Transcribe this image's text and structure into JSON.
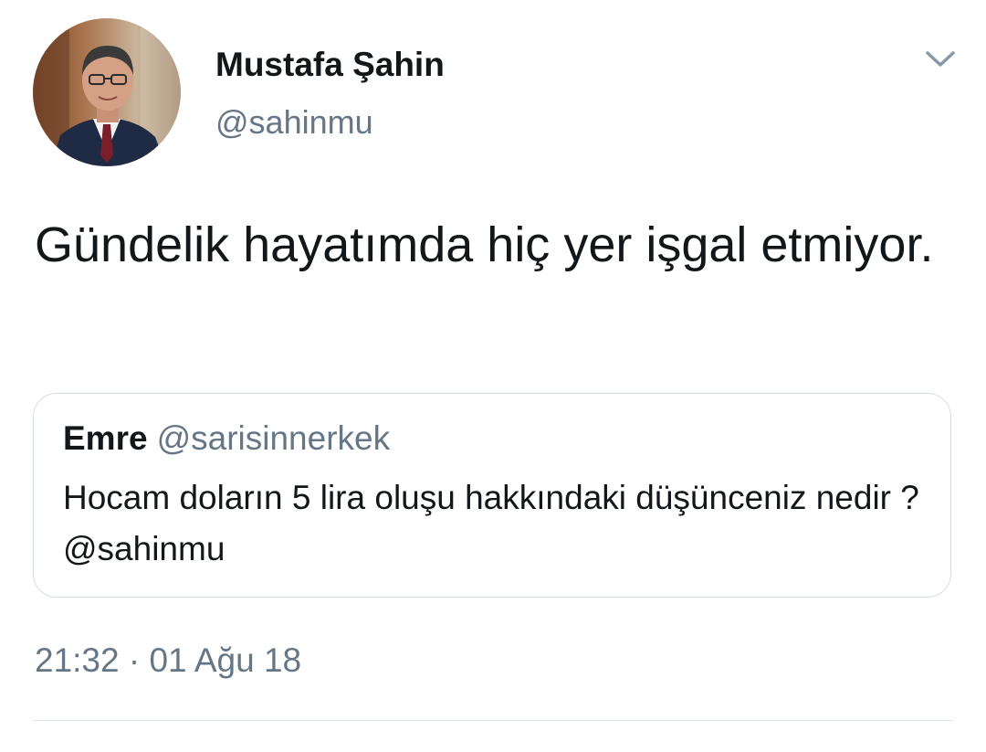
{
  "tweet": {
    "author": {
      "name": "Mustafa Şahin",
      "handle": "@sahinmu",
      "avatar": "avatar-photo"
    },
    "menu_icon": "chevron-down-icon",
    "text": "Gündelik hayatımda hiç yer işgal etmiyor.",
    "quoted_tweet": {
      "name": "Emre",
      "handle": "@sarisinnerkek",
      "text": "Hocam doların 5 lira oluşu hakkındaki düşünceniz nedir ?@sahinmu"
    },
    "timestamp": "21:32 · 01 Ağu 18"
  },
  "colors": {
    "text_primary": "#14171a",
    "text_secondary": "#657786",
    "border": "#d5dde3",
    "divider": "#e1e8ed"
  }
}
